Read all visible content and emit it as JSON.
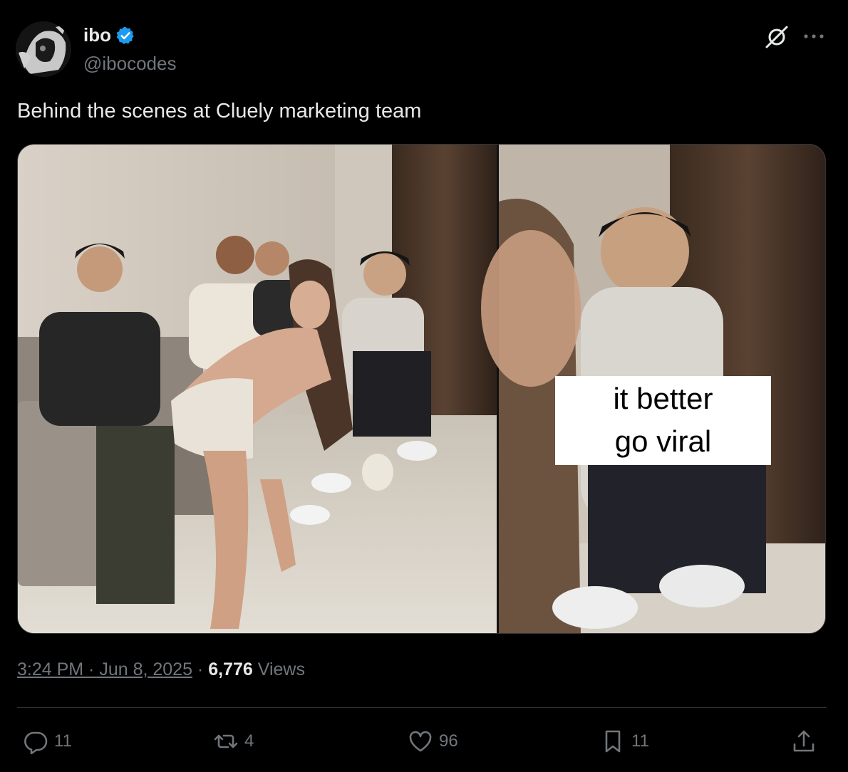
{
  "author": {
    "display_name": "ibo",
    "handle": "@ibocodes",
    "verified": true
  },
  "tweet": {
    "text": "Behind the scenes at Cluely marketing team",
    "video_caption_line1": "it better",
    "video_caption_line2": "go viral"
  },
  "meta": {
    "time": "3:24 PM · Jun 8, 2025",
    "separator": " · ",
    "views_count": "6,776",
    "views_label": "Views"
  },
  "actions": {
    "replies": "11",
    "reposts": "4",
    "likes": "96",
    "bookmarks": "11"
  },
  "colors": {
    "background": "#000000",
    "text": "#e7e9ea",
    "muted": "#71767b",
    "verified": "#1d9bf0",
    "border": "#2f3336"
  },
  "icons": [
    "verified-badge-icon",
    "grok-icon",
    "more-icon",
    "reply-icon",
    "repost-icon",
    "like-icon",
    "bookmark-icon",
    "share-icon"
  ]
}
